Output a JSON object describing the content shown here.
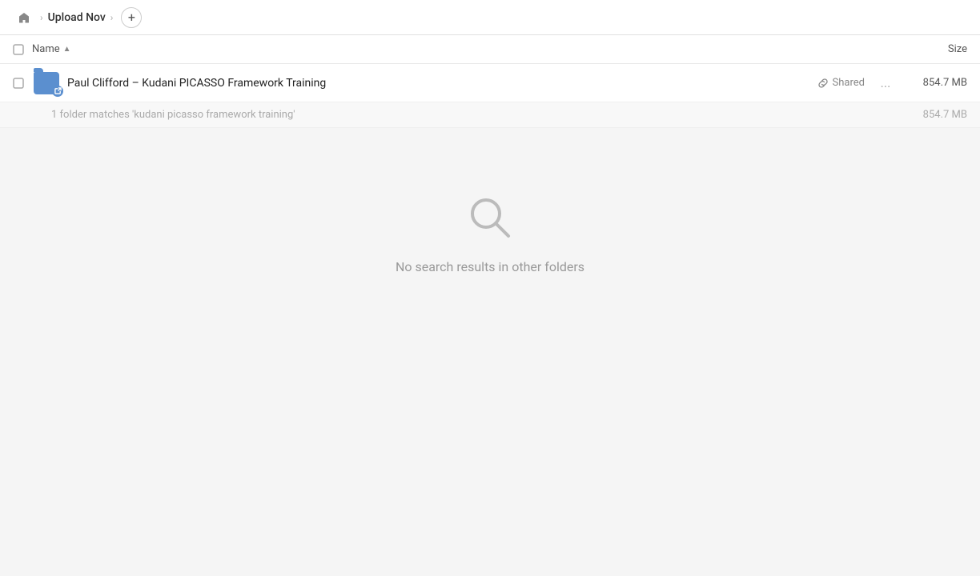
{
  "breadcrumb": {
    "home_label": "Home",
    "parent_label": "Upload Nov",
    "add_button_label": "+"
  },
  "columns": {
    "name_label": "Name",
    "sort_direction": "asc",
    "size_label": "Size"
  },
  "file_row": {
    "name": "Paul Clifford – Kudani PICASSO Framework Training",
    "shared_label": "Shared",
    "more_label": "...",
    "size": "854.7 MB"
  },
  "match_row": {
    "text": "1 folder matches 'kudani picasso framework training'",
    "size": "854.7 MB"
  },
  "empty_state": {
    "icon": "search",
    "message": "No search results in other folders"
  }
}
